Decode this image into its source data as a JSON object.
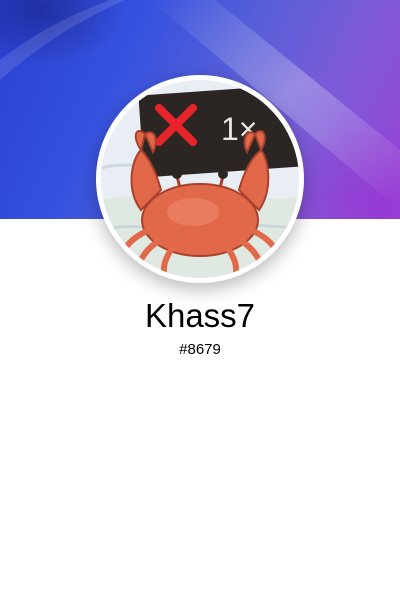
{
  "profile": {
    "username": "Khass7",
    "discriminator": "#8679",
    "avatar_sign_text": "1×",
    "avatar_icon": "crab-holding-sign-icon"
  },
  "colors": {
    "banner_start": "#2b3fd0",
    "banner_end": "#9a45d6",
    "ring": "#ffffff",
    "crab": "#e2684a"
  }
}
